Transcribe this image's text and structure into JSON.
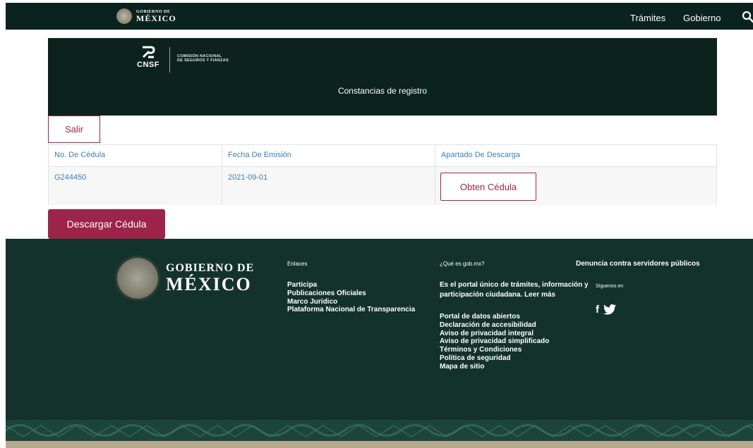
{
  "topnav": {
    "logo_line1": "GOBIERNO DE",
    "logo_line2": "MÉXICO",
    "links": [
      "Trámites",
      "Gobierno"
    ],
    "search_icon": "search-icon"
  },
  "cnsf": {
    "abbr": "CNSF",
    "name_line1": "COMISIÓN NACIONAL",
    "name_line2": "DE SEGUROS Y FIANZAS",
    "title": "Constancias de registro"
  },
  "actions": {
    "salir_label": "Salir",
    "descargar_label": "Descargar Cédula"
  },
  "table": {
    "headers": [
      "No. De Cédula",
      "Fecha De Emisión",
      "Apartado De Descarga"
    ],
    "rows": [
      {
        "cedula": "G244450",
        "fecha": "2021-09-01",
        "button": "Obten Cédula"
      }
    ]
  },
  "footer": {
    "logo_line1": "GOBIERNO DE",
    "logo_line2": "MÉXICO",
    "enlaces_title": "Enlaces",
    "enlaces": [
      "Participa",
      "Publicaciones Oficiales",
      "Marco Jurídico",
      "Plataforma Nacional de Transparencia"
    ],
    "que_es_title": "¿Qué es gob.mx?",
    "que_es_desc": "Es el portal único de trámites, información y participación ciudadana.",
    "leer_mas": "Leer más",
    "links": [
      "Portal de datos abiertos",
      "Declaración de accesibilidad",
      "Aviso de privacidad integral",
      "Aviso de privacidad simplificado",
      "Términos y Condiciones",
      "Política de seguridad",
      "Mapa de sitio"
    ],
    "denuncia": "Denuncia contra servidores públicos",
    "siguenos": "Síguenos en",
    "social_icons": [
      "facebook-icon",
      "twitter-icon"
    ]
  },
  "colors": {
    "nav_bg": "#0b231e",
    "header_bg": "#0c231d",
    "footer_bg": "#13322b",
    "accent": "#9d2449",
    "link": "#3d7fb7"
  }
}
